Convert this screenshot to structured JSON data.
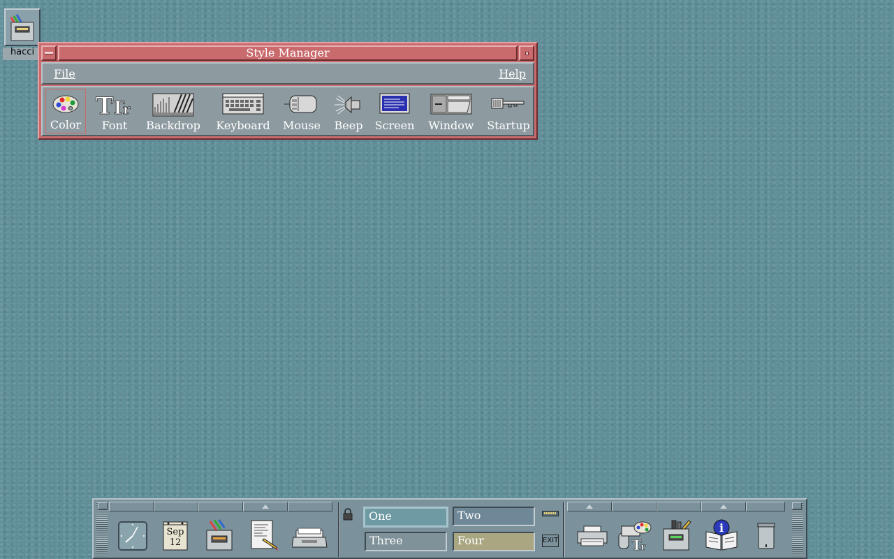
{
  "desktop": {
    "icon_label": "hacci"
  },
  "style_manager": {
    "title": "Style Manager",
    "menu": {
      "file": "File",
      "help": "Help"
    },
    "tools": [
      {
        "label": "Color",
        "icon": "palette-icon"
      },
      {
        "label": "Font",
        "icon": "font-icon"
      },
      {
        "label": "Backdrop",
        "icon": "backdrop-icon"
      },
      {
        "label": "Keyboard",
        "icon": "keyboard-icon"
      },
      {
        "label": "Mouse",
        "icon": "mouse-icon"
      },
      {
        "label": "Beep",
        "icon": "speaker-icon"
      },
      {
        "label": "Screen",
        "icon": "monitor-icon"
      },
      {
        "label": "Window",
        "icon": "window-icon"
      },
      {
        "label": "Startup",
        "icon": "key-icon"
      }
    ],
    "selected_tool": "Color"
  },
  "front_panel": {
    "calendar": {
      "month": "Sep",
      "day": "12"
    },
    "workspaces": [
      "One",
      "Two",
      "Three",
      "Four"
    ],
    "active_workspace": "One",
    "exit_label": "EXIT",
    "colors": {
      "ws_one": "#6e9aa4",
      "ws_two": "#6f8898",
      "ws_three": "#7f9299",
      "ws_four": "#aaa682"
    }
  }
}
